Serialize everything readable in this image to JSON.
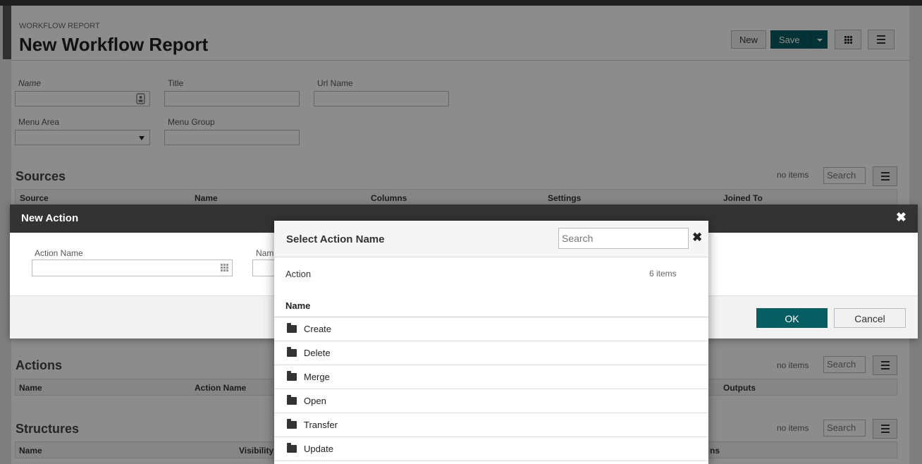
{
  "header": {
    "eyebrow": "WORKFLOW REPORT",
    "title": "New Workflow Report"
  },
  "toolbar": {
    "new_label": "New",
    "save_label": "Save"
  },
  "form": {
    "name_label": "Name",
    "title_label": "Title",
    "url_name_label": "Url Name",
    "menu_area_label": "Menu Area",
    "menu_group_label": "Menu Group"
  },
  "sources": {
    "title": "Sources",
    "no_items": "no items",
    "search_placeholder": "Search",
    "columns": [
      "Source",
      "Name",
      "Columns",
      "Settings",
      "Joined To"
    ]
  },
  "actions": {
    "title": "Actions",
    "no_items": "no items",
    "search_placeholder": "Search",
    "columns": [
      "Name",
      "Action Name",
      "Outputs"
    ]
  },
  "structures": {
    "title": "Structures",
    "no_items": "no items",
    "search_placeholder": "Search",
    "columns": [
      "Name",
      "Visibility",
      "ns"
    ]
  },
  "dialog": {
    "title": "New Action",
    "close_glyph": "✖",
    "action_name_label": "Action Name",
    "name_label_partial": "Nam",
    "ok_label": "OK",
    "cancel_label": "Cancel"
  },
  "picker": {
    "title": "Select Action Name",
    "search_placeholder": "Search",
    "close_glyph": "✖",
    "list_title": "Action",
    "count": "6 items",
    "column_header": "Name",
    "items": [
      "Create",
      "Delete",
      "Merge",
      "Open",
      "Transfer",
      "Update"
    ]
  },
  "colors": {
    "accent": "#065e63",
    "dialog_header": "#333333"
  },
  "icons": [
    "contact-card-icon",
    "dropdown-arrow-icon",
    "grid-icon",
    "menu-icon",
    "close-icon",
    "folder-icon"
  ]
}
